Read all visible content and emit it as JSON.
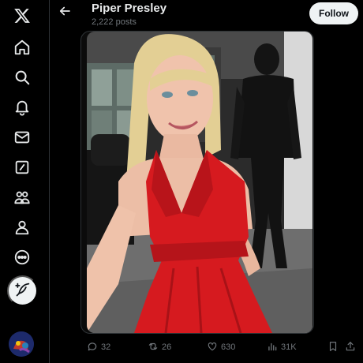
{
  "profile": {
    "name": "Piper Presley",
    "posts_count": "2,222 posts",
    "follow_label": "Follow"
  },
  "nav": {
    "items": [
      {
        "icon": "x-logo-icon"
      },
      {
        "icon": "home-icon"
      },
      {
        "icon": "search-icon"
      },
      {
        "icon": "bell-icon"
      },
      {
        "icon": "mail-icon"
      },
      {
        "icon": "grok-icon"
      },
      {
        "icon": "communities-icon"
      },
      {
        "icon": "profile-icon"
      },
      {
        "icon": "more-icon"
      }
    ],
    "compose_icon": "feather-plus-icon"
  },
  "post": {
    "stats": {
      "replies": "32",
      "reposts": "26",
      "likes": "630",
      "views": "31K"
    }
  },
  "colors": {
    "background": "#000000",
    "text": "#e7e9ea",
    "muted": "#71767b",
    "border": "#2f3336",
    "button_bg": "#eff3f4"
  }
}
